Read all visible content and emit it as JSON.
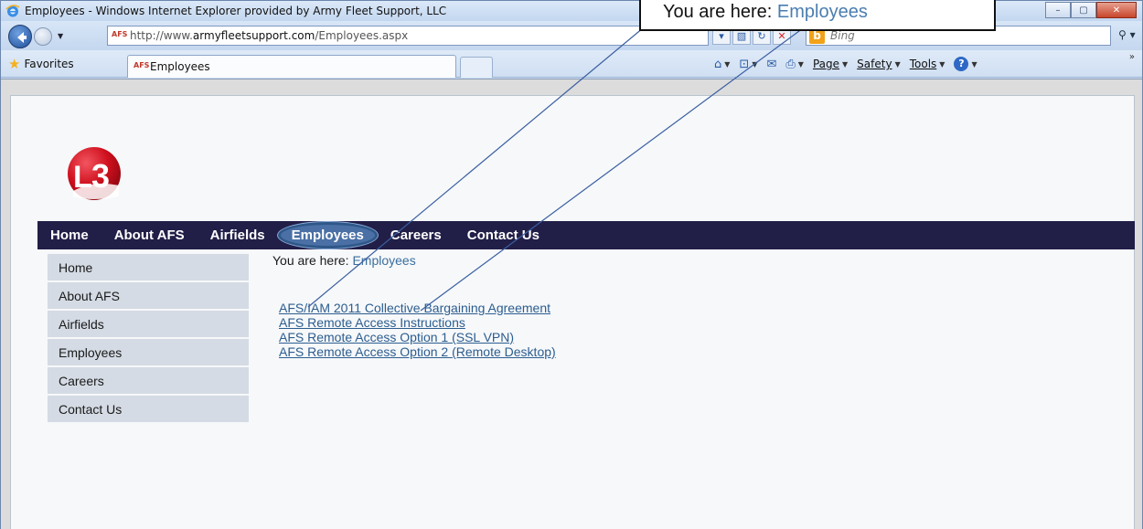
{
  "window": {
    "title": "Employees - Windows Internet Explorer provided by Army Fleet Support, LLC",
    "minimize_label": "–",
    "maximize_label": "▢",
    "close_label": "✕"
  },
  "address": {
    "url_prefix": "http://www.",
    "url_domain": "armyfleetsupport.com",
    "url_path": "/Employees.aspx",
    "favicon_text": "AFS"
  },
  "search": {
    "placeholder": "Bing",
    "logo_text": "b"
  },
  "favorites": {
    "label": "Favorites",
    "tab_label": "Employees",
    "tab_favicon": "AFS"
  },
  "commandbar": {
    "page_label": "Page",
    "safety_label": "Safety",
    "tools_label": "Tools",
    "help_label": "?"
  },
  "topnav": {
    "items": [
      "Home",
      "About AFS",
      "Airfields",
      "Employees",
      "Careers",
      "Contact Us"
    ],
    "active": "Employees"
  },
  "sidebar": {
    "items": [
      "Home",
      "About AFS",
      "Airfields",
      "Employees",
      "Careers",
      "Contact Us"
    ]
  },
  "breadcrumb": {
    "prefix": "You are here: ",
    "current": "Employees"
  },
  "links": [
    "AFS/IAM 2011 Collective Bargaining Agreement",
    "AFS Remote Access Instructions",
    "AFS Remote Access Option 1 (SSL VPN)",
    "AFS Remote Access Option 2 (Remote Desktop)"
  ],
  "callout": {
    "prefix": "You are here: ",
    "current": "Employees"
  },
  "logo": {
    "text": "3",
    "letter": "L"
  },
  "colors": {
    "nav_bg": "#211e48",
    "link": "#2c5d8f",
    "sidebar_bg": "#d4dbe4",
    "logo_red": "#d0101e"
  }
}
